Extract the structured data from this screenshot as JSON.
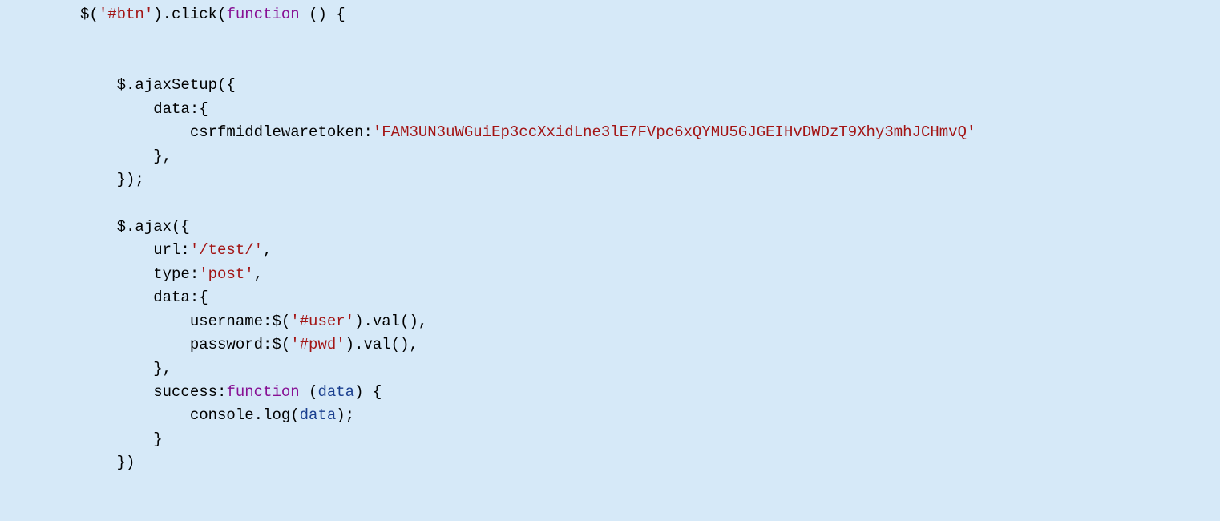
{
  "tokens": {
    "t01": "$(",
    "t02": "'#btn'",
    "t03": ").click(",
    "t04": "function",
    "t05": " () {",
    "t06": "    $.ajaxSetup({",
    "t07": "        data:{",
    "t08": "            csrfmiddlewaretoken:",
    "t09": "'FAM3UN3uWGuiEp3ccXxidLne3lE7FVpc6xQYMU5GJGEIHvDWDzT9Xhy3mhJCHmvQ'",
    "t10": "        },",
    "t11": "    });",
    "t12": "    $.ajax({",
    "t13": "        url:",
    "t14": "'/test/'",
    "t15": ",",
    "t16": "        type:",
    "t17": "'post'",
    "t18": ",",
    "t19": "        data:{",
    "t20": "            username:$(",
    "t21": "'#user'",
    "t22": ").val(),",
    "t23": "            password:$(",
    "t24": "'#pwd'",
    "t25": ").val(),",
    "t26": "        },",
    "t27": "        success:",
    "t28": "function",
    "t29": " (",
    "t30": "data",
    "t31": ") {",
    "t32": "            console.log(",
    "t33": "data",
    "t34": ");",
    "t35": "        }",
    "t36": "    })"
  }
}
